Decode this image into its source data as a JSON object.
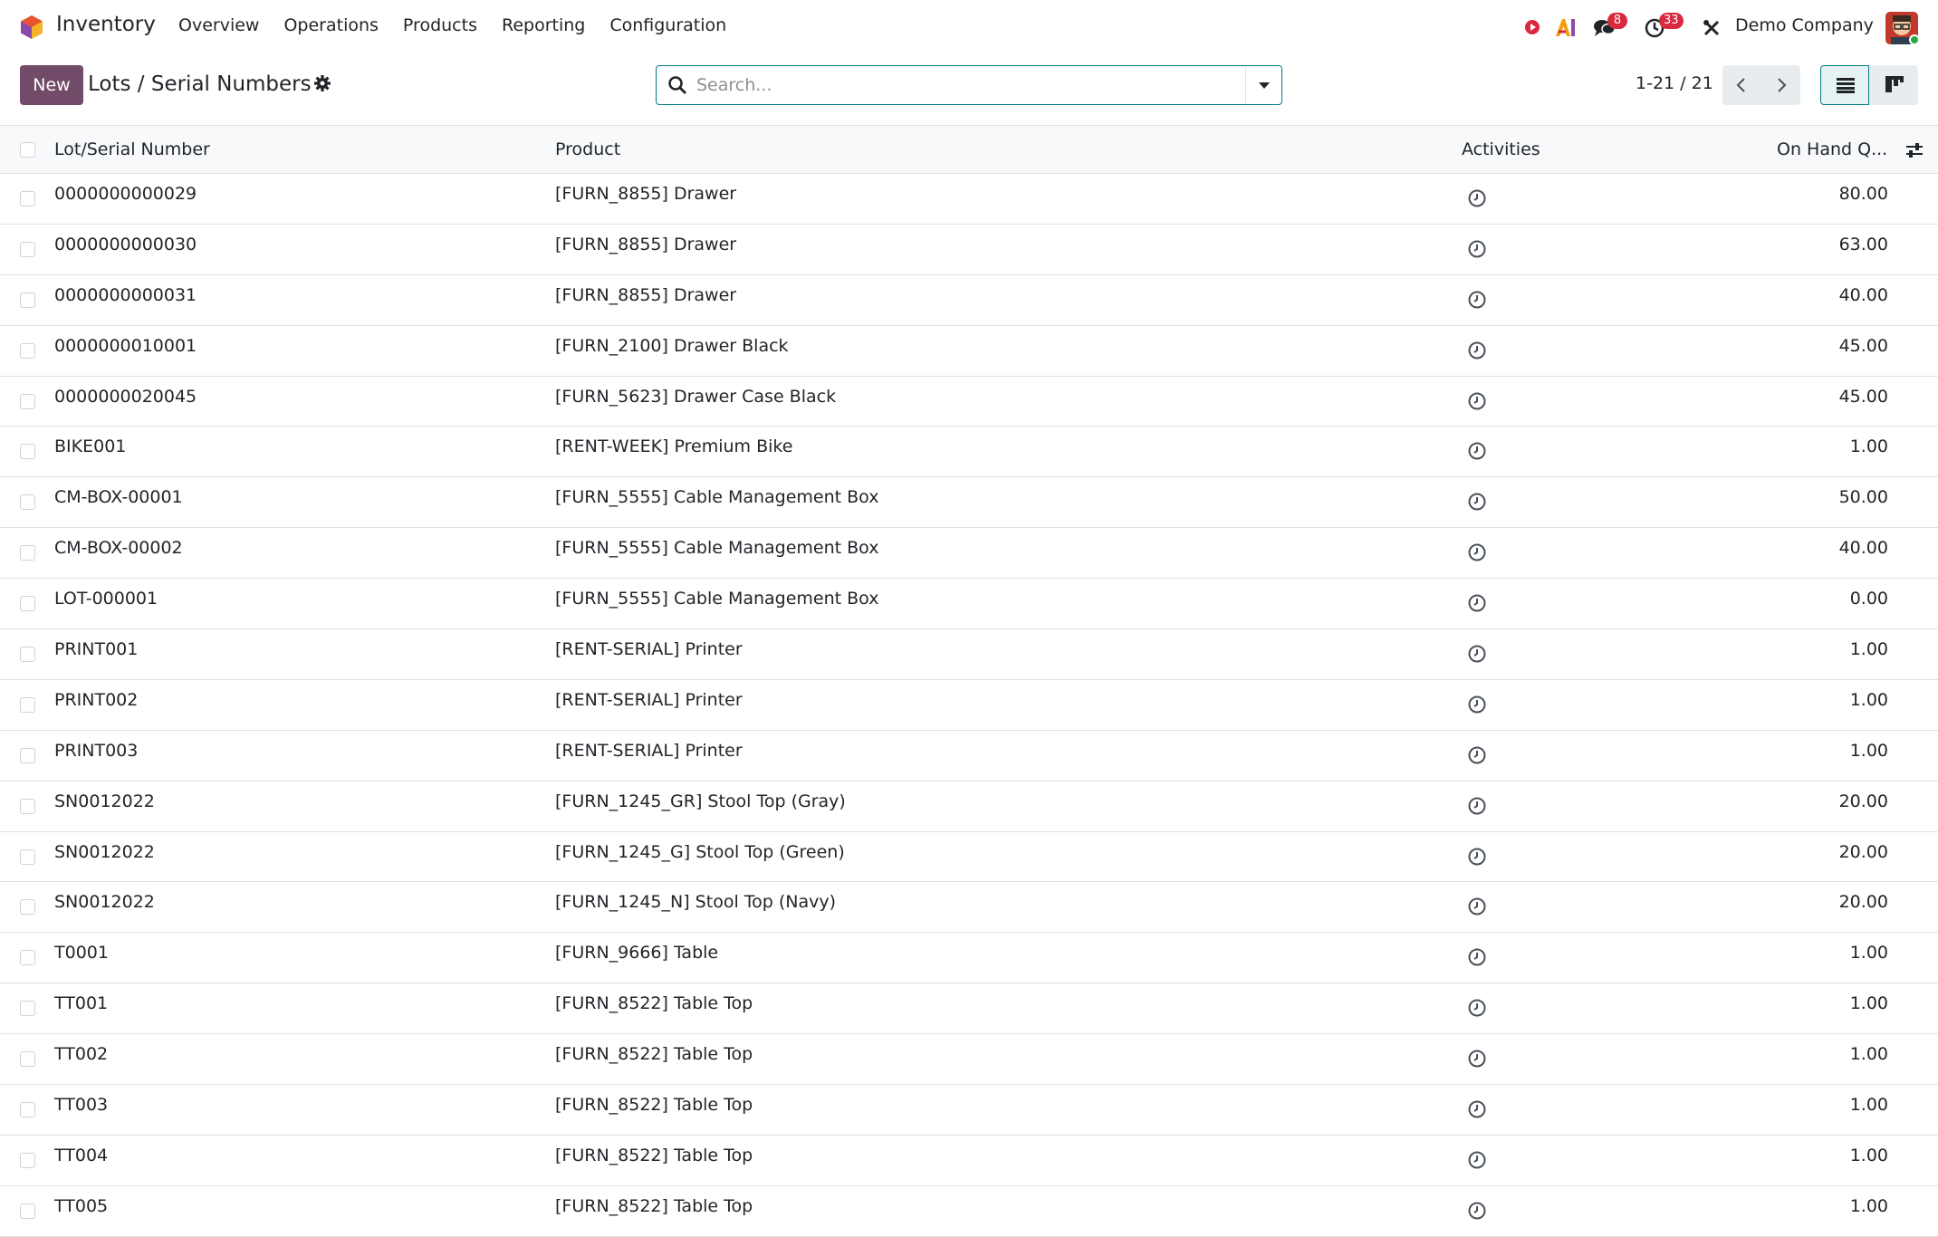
{
  "app": {
    "name": "Inventory",
    "menu": [
      "Overview",
      "Operations",
      "Products",
      "Reporting",
      "Configuration"
    ],
    "company": "Demo Company",
    "messages_badge": "8",
    "activities_badge": "33"
  },
  "control": {
    "new_label": "New",
    "breadcrumb": "Lots / Serial Numbers",
    "search_placeholder": "Search...",
    "pager": "1-21 / 21"
  },
  "table": {
    "columns": {
      "lot": "Lot/Serial Number",
      "product": "Product",
      "activities": "Activities",
      "qty": "On Hand Q..."
    },
    "rows": [
      {
        "lot": "0000000000029",
        "product": "[FURN_8855] Drawer",
        "qty": "80.00"
      },
      {
        "lot": "0000000000030",
        "product": "[FURN_8855] Drawer",
        "qty": "63.00"
      },
      {
        "lot": "0000000000031",
        "product": "[FURN_8855] Drawer",
        "qty": "40.00"
      },
      {
        "lot": "0000000010001",
        "product": "[FURN_2100] Drawer Black",
        "qty": "45.00"
      },
      {
        "lot": "0000000020045",
        "product": "[FURN_5623] Drawer Case Black",
        "qty": "45.00"
      },
      {
        "lot": "BIKE001",
        "product": "[RENT-WEEK] Premium Bike",
        "qty": "1.00"
      },
      {
        "lot": "CM-BOX-00001",
        "product": "[FURN_5555] Cable Management Box",
        "qty": "50.00"
      },
      {
        "lot": "CM-BOX-00002",
        "product": "[FURN_5555] Cable Management Box",
        "qty": "40.00"
      },
      {
        "lot": "LOT-000001",
        "product": "[FURN_5555] Cable Management Box",
        "qty": "0.00"
      },
      {
        "lot": "PRINT001",
        "product": "[RENT-SERIAL] Printer",
        "qty": "1.00"
      },
      {
        "lot": "PRINT002",
        "product": "[RENT-SERIAL] Printer",
        "qty": "1.00"
      },
      {
        "lot": "PRINT003",
        "product": "[RENT-SERIAL] Printer",
        "qty": "1.00"
      },
      {
        "lot": "SN0012022",
        "product": "[FURN_1245_GR] Stool Top (Gray)",
        "qty": "20.00"
      },
      {
        "lot": "SN0012022",
        "product": "[FURN_1245_G] Stool Top (Green)",
        "qty": "20.00"
      },
      {
        "lot": "SN0012022",
        "product": "[FURN_1245_N] Stool Top (Navy)",
        "qty": "20.00"
      },
      {
        "lot": "T0001",
        "product": "[FURN_9666] Table",
        "qty": "1.00"
      },
      {
        "lot": "TT001",
        "product": "[FURN_8522] Table Top",
        "qty": "1.00"
      },
      {
        "lot": "TT002",
        "product": "[FURN_8522] Table Top",
        "qty": "1.00"
      },
      {
        "lot": "TT003",
        "product": "[FURN_8522] Table Top",
        "qty": "1.00"
      },
      {
        "lot": "TT004",
        "product": "[FURN_8522] Table Top",
        "qty": "1.00"
      },
      {
        "lot": "TT005",
        "product": "[FURN_8522] Table Top",
        "qty": "1.00"
      }
    ]
  },
  "colors": {
    "brand": "#714b67",
    "accent": "#017e84",
    "badge": "#d9293e"
  }
}
